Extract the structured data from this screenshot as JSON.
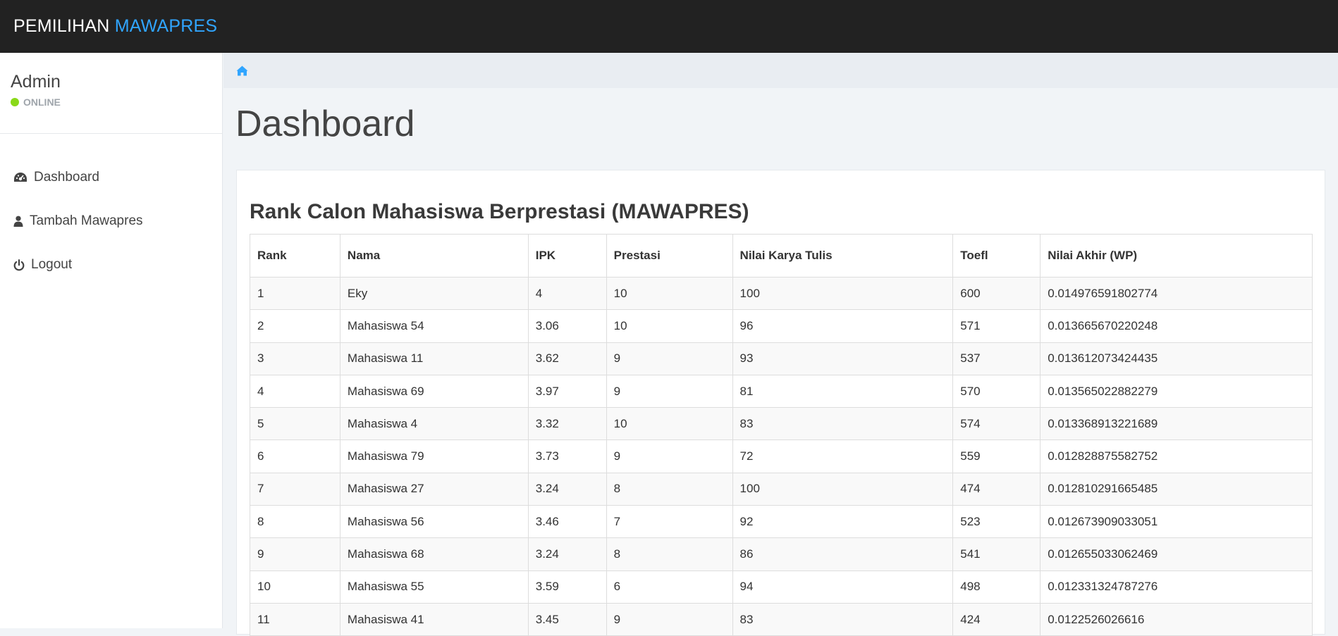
{
  "brand": {
    "text": "PEMILIHAN ",
    "accent": "MAWAPRES",
    "accent_color": "#30a5ff"
  },
  "user": {
    "name": "Admin",
    "status": "ONLINE",
    "status_color": "#8ad919"
  },
  "menu": [
    {
      "label": "Dashboard",
      "icon": "dashboard-icon"
    },
    {
      "label": "Tambah Mawapres",
      "icon": "user-icon"
    },
    {
      "label": "Logout",
      "icon": "power-icon"
    }
  ],
  "breadcrumb": {
    "icon": "home-icon"
  },
  "page": {
    "title": "Dashboard"
  },
  "panel": {
    "title": "Rank Calon Mahasiswa Berprestasi (MAWAPRES)"
  },
  "table": {
    "headers": [
      "Rank",
      "Nama",
      "IPK",
      "Prestasi",
      "Nilai Karya Tulis",
      "Toefl",
      "Nilai Akhir (WP)"
    ],
    "rows": [
      [
        "1",
        "Eky",
        "4",
        "10",
        "100",
        "600",
        "0.014976591802774"
      ],
      [
        "2",
        "Mahasiswa 54",
        "3.06",
        "10",
        "96",
        "571",
        "0.013665670220248"
      ],
      [
        "3",
        "Mahasiswa 11",
        "3.62",
        "9",
        "93",
        "537",
        "0.013612073424435"
      ],
      [
        "4",
        "Mahasiswa 69",
        "3.97",
        "9",
        "81",
        "570",
        "0.013565022882279"
      ],
      [
        "5",
        "Mahasiswa 4",
        "3.32",
        "10",
        "83",
        "574",
        "0.013368913221689"
      ],
      [
        "6",
        "Mahasiswa 79",
        "3.73",
        "9",
        "72",
        "559",
        "0.012828875582752"
      ],
      [
        "7",
        "Mahasiswa 27",
        "3.24",
        "8",
        "100",
        "474",
        "0.012810291665485"
      ],
      [
        "8",
        "Mahasiswa 56",
        "3.46",
        "7",
        "92",
        "523",
        "0.012673909033051"
      ],
      [
        "9",
        "Mahasiswa 68",
        "3.24",
        "8",
        "86",
        "541",
        "0.012655033062469"
      ],
      [
        "10",
        "Mahasiswa 55",
        "3.59",
        "6",
        "94",
        "498",
        "0.012331324787276"
      ],
      [
        "11",
        "Mahasiswa 41",
        "3.45",
        "9",
        "83",
        "424",
        "0.0122526026616"
      ]
    ]
  }
}
